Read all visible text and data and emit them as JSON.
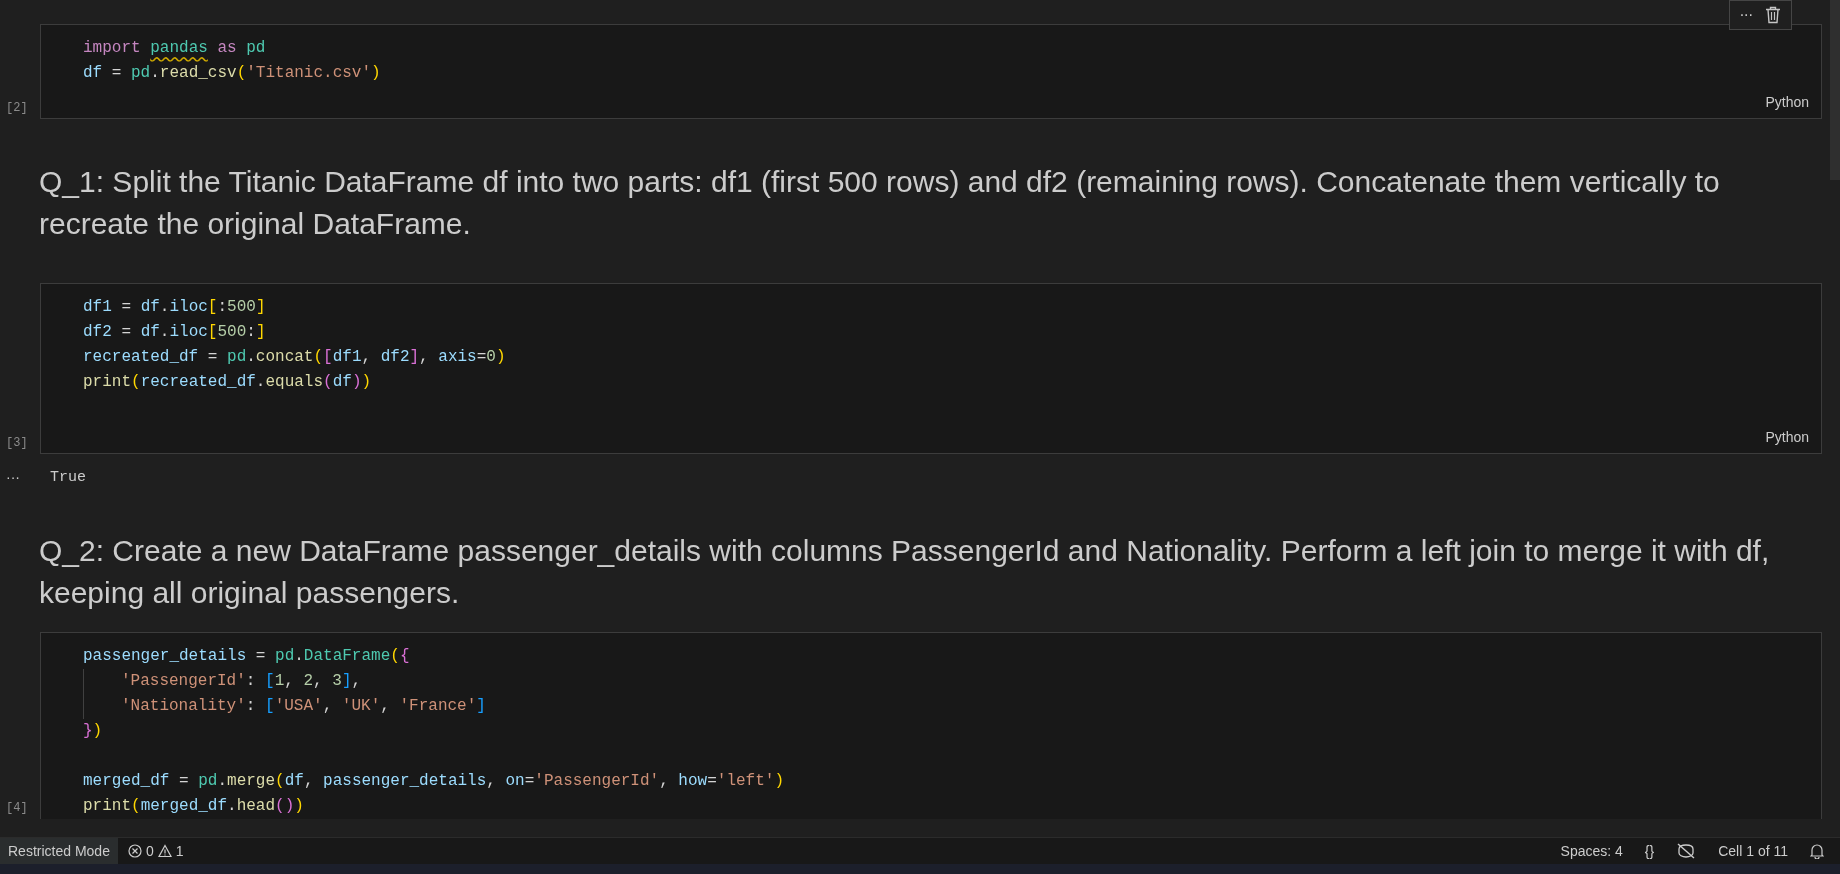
{
  "toolbar": {
    "more": "···"
  },
  "cells": [
    {
      "kind": "code",
      "count": "[2]",
      "language": "Python",
      "blocks": [
        [
          {
            "indented": false,
            "tokens": [
              {
                "t": "import ",
                "kind": "kw"
              },
              {
                "t": "pandas",
                "kind": "warned"
              },
              {
                "t": " as ",
                "kind": "kw"
              },
              {
                "t": "pd",
                "kind": "mod"
              }
            ]
          },
          {
            "indented": false,
            "tokens": [
              {
                "t": "df",
                "kind": "var"
              },
              {
                "t": " = ",
                "kind": "plain"
              },
              {
                "t": "pd",
                "kind": "mod"
              },
              {
                "t": ".",
                "kind": "plain"
              },
              {
                "t": "read_csv",
                "kind": "fn"
              },
              {
                "t": "(",
                "kind": "b1"
              },
              {
                "t": "'Titanic.csv'",
                "kind": "str"
              },
              {
                "t": ")",
                "kind": "b1"
              }
            ]
          }
        ]
      ]
    },
    {
      "kind": "markdown",
      "text": "Q_1: Split the Titanic DataFrame df into two parts: df1 (first 500 rows) and df2 (remaining rows). Concatenate them vertically to recreate the original DataFrame."
    },
    {
      "kind": "code",
      "count": "[3]",
      "language": "Python",
      "output": {
        "marker": "···",
        "text": "True"
      },
      "blocks": [
        [
          {
            "indented": false,
            "tokens": [
              {
                "t": "df1",
                "kind": "var"
              },
              {
                "t": " = ",
                "kind": "plain"
              },
              {
                "t": "df",
                "kind": "var"
              },
              {
                "t": ".",
                "kind": "plain"
              },
              {
                "t": "iloc",
                "kind": "var"
              },
              {
                "t": "[",
                "kind": "b1"
              },
              {
                "t": ":",
                "kind": "plain"
              },
              {
                "t": "500",
                "kind": "num"
              },
              {
                "t": "]",
                "kind": "b1"
              }
            ]
          },
          {
            "indented": false,
            "tokens": [
              {
                "t": "df2",
                "kind": "var"
              },
              {
                "t": " = ",
                "kind": "plain"
              },
              {
                "t": "df",
                "kind": "var"
              },
              {
                "t": ".",
                "kind": "plain"
              },
              {
                "t": "iloc",
                "kind": "var"
              },
              {
                "t": "[",
                "kind": "b1"
              },
              {
                "t": "500",
                "kind": "num"
              },
              {
                "t": ":",
                "kind": "plain"
              },
              {
                "t": "]",
                "kind": "b1"
              }
            ]
          },
          {
            "indented": false,
            "tokens": [
              {
                "t": "recreated_df",
                "kind": "var"
              },
              {
                "t": " = ",
                "kind": "plain"
              },
              {
                "t": "pd",
                "kind": "mod"
              },
              {
                "t": ".",
                "kind": "plain"
              },
              {
                "t": "concat",
                "kind": "fn"
              },
              {
                "t": "(",
                "kind": "b1"
              },
              {
                "t": "[",
                "kind": "b2"
              },
              {
                "t": "df1",
                "kind": "var"
              },
              {
                "t": ", ",
                "kind": "plain"
              },
              {
                "t": "df2",
                "kind": "var"
              },
              {
                "t": "]",
                "kind": "b2"
              },
              {
                "t": ", ",
                "kind": "plain"
              },
              {
                "t": "axis",
                "kind": "var"
              },
              {
                "t": "=",
                "kind": "plain"
              },
              {
                "t": "0",
                "kind": "num"
              },
              {
                "t": ")",
                "kind": "b1"
              }
            ]
          },
          {
            "indented": false,
            "tokens": [
              {
                "t": "print",
                "kind": "fn"
              },
              {
                "t": "(",
                "kind": "b1"
              },
              {
                "t": "recreated_df",
                "kind": "var"
              },
              {
                "t": ".",
                "kind": "plain"
              },
              {
                "t": "equals",
                "kind": "fn"
              },
              {
                "t": "(",
                "kind": "b2"
              },
              {
                "t": "df",
                "kind": "var"
              },
              {
                "t": ")",
                "kind": "b2"
              },
              {
                "t": ")",
                "kind": "b1"
              }
            ]
          }
        ]
      ]
    },
    {
      "kind": "markdown",
      "text": "Q_2: Create a new DataFrame passenger_details with columns PassengerId and Nationality. Perform a left join to merge it with df, keeping all original passengers."
    },
    {
      "kind": "code",
      "count": "[4]",
      "blocks": [
        [
          {
            "indented": false,
            "tokens": [
              {
                "t": "passenger_details",
                "kind": "var"
              },
              {
                "t": " = ",
                "kind": "plain"
              },
              {
                "t": "pd",
                "kind": "mod"
              },
              {
                "t": ".",
                "kind": "plain"
              },
              {
                "t": "DataFrame",
                "kind": "mod"
              },
              {
                "t": "(",
                "kind": "b1"
              },
              {
                "t": "{",
                "kind": "b2"
              }
            ]
          },
          {
            "indented": true,
            "tokens": [
              {
                "t": "'PassengerId'",
                "kind": "str"
              },
              {
                "t": ": ",
                "kind": "plain"
              },
              {
                "t": "[",
                "kind": "b3"
              },
              {
                "t": "1",
                "kind": "num"
              },
              {
                "t": ", ",
                "kind": "plain"
              },
              {
                "t": "2",
                "kind": "num"
              },
              {
                "t": ", ",
                "kind": "plain"
              },
              {
                "t": "3",
                "kind": "num"
              },
              {
                "t": "]",
                "kind": "b3"
              },
              {
                "t": ",",
                "kind": "plain"
              }
            ]
          },
          {
            "indented": true,
            "tokens": [
              {
                "t": "'Nationality'",
                "kind": "str"
              },
              {
                "t": ": ",
                "kind": "plain"
              },
              {
                "t": "[",
                "kind": "b3"
              },
              {
                "t": "'USA'",
                "kind": "str"
              },
              {
                "t": ", ",
                "kind": "plain"
              },
              {
                "t": "'UK'",
                "kind": "str"
              },
              {
                "t": ", ",
                "kind": "plain"
              },
              {
                "t": "'France'",
                "kind": "str"
              },
              {
                "t": "]",
                "kind": "b3"
              }
            ]
          },
          {
            "indented": false,
            "tokens": [
              {
                "t": "}",
                "kind": "b2"
              },
              {
                "t": ")",
                "kind": "b1"
              }
            ]
          }
        ],
        [
          {
            "indented": false,
            "tokens": [
              {
                "t": "merged_df",
                "kind": "var"
              },
              {
                "t": " = ",
                "kind": "plain"
              },
              {
                "t": "pd",
                "kind": "mod"
              },
              {
                "t": ".",
                "kind": "plain"
              },
              {
                "t": "merge",
                "kind": "fn"
              },
              {
                "t": "(",
                "kind": "b1"
              },
              {
                "t": "df",
                "kind": "var"
              },
              {
                "t": ", ",
                "kind": "plain"
              },
              {
                "t": "passenger_details",
                "kind": "var"
              },
              {
                "t": ", ",
                "kind": "plain"
              },
              {
                "t": "on",
                "kind": "var"
              },
              {
                "t": "=",
                "kind": "plain"
              },
              {
                "t": "'PassengerId'",
                "kind": "str"
              },
              {
                "t": ", ",
                "kind": "plain"
              },
              {
                "t": "how",
                "kind": "var"
              },
              {
                "t": "=",
                "kind": "plain"
              },
              {
                "t": "'left'",
                "kind": "str"
              },
              {
                "t": ")",
                "kind": "b1"
              }
            ]
          },
          {
            "indented": false,
            "tokens": [
              {
                "t": "print",
                "kind": "fn"
              },
              {
                "t": "(",
                "kind": "b1"
              },
              {
                "t": "merged_df",
                "kind": "var"
              },
              {
                "t": ".",
                "kind": "plain"
              },
              {
                "t": "head",
                "kind": "fn"
              },
              {
                "t": "(",
                "kind": "b2"
              },
              {
                "t": ")",
                "kind": "b2"
              },
              {
                "t": ")",
                "kind": "b1"
              }
            ]
          }
        ]
      ]
    }
  ],
  "status_bar": {
    "mode": "Restricted Mode",
    "errors": "0",
    "warnings": "1",
    "spaces": "Spaces: 4",
    "braces": "{}",
    "cell": "Cell 1 of 11"
  }
}
